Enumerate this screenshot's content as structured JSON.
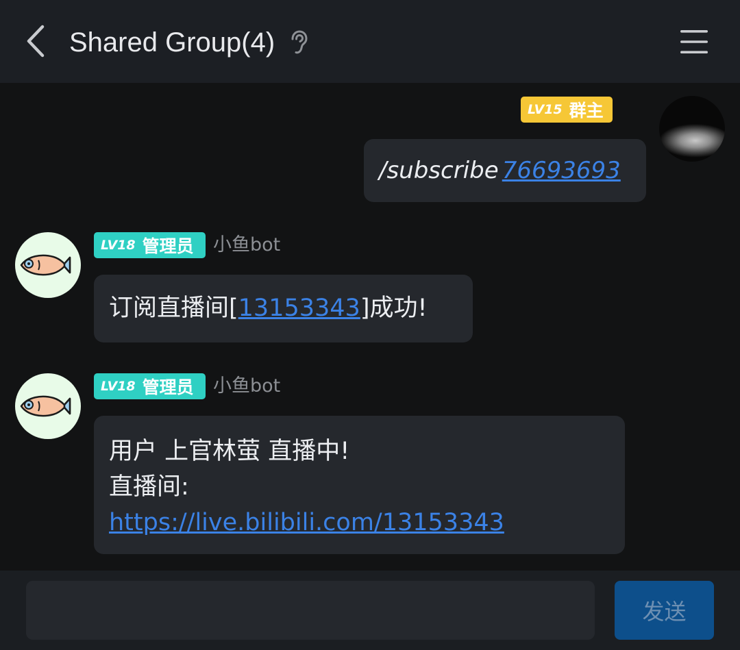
{
  "header": {
    "title": "Shared Group(4)"
  },
  "messages": [
    {
      "badge_level": "LV15",
      "badge_role": "群主",
      "command": "/subscribe",
      "command_arg": "76693693"
    },
    {
      "badge_level": "LV18",
      "badge_role": "管理员",
      "sender": "小鱼bot",
      "text_before": "订阅直播间[",
      "link": "13153343",
      "text_after": "]成功!"
    },
    {
      "badge_level": "LV18",
      "badge_role": "管理员",
      "sender": "小鱼bot",
      "line1": "用户 上官林萤 直播中!",
      "line2": "直播间:",
      "link": "https://live.bilibili.com/13153343"
    }
  ],
  "input": {
    "value": "",
    "send_label": "发送"
  },
  "colors": {
    "owner_badge": "#f6c736",
    "admin_badge": "#2fd0c3",
    "link": "#3b82e6",
    "send_button": "#0d4f8b"
  },
  "icons": [
    "back-chevron-icon",
    "ear-icon",
    "menu-icon",
    "fish-icon"
  ]
}
